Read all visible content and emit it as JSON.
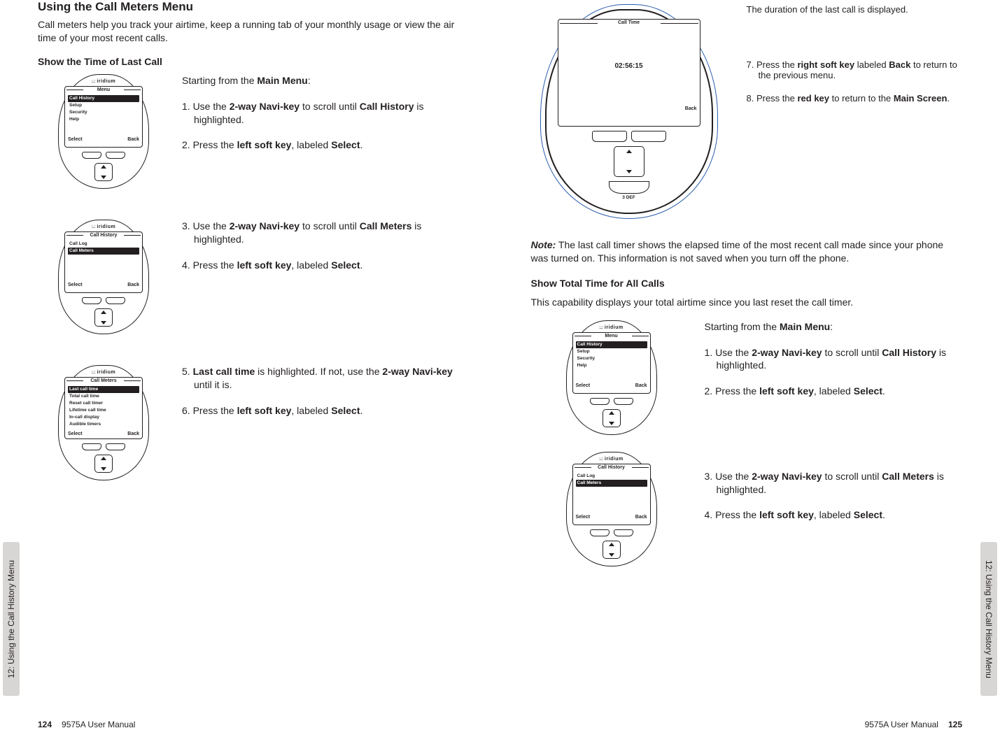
{
  "chapter_tab": "12: Using the Call History Menu",
  "footer_manual": "9575A User Manual",
  "page_left_num": "124",
  "page_right_num": "125",
  "left": {
    "title": "Using the Call Meters Menu",
    "intro": "Call meters help you track your airtime, keep a running tab of your monthly usage or view the air time of your most recent calls.",
    "sub1": "Show the Time of Last Call",
    "block1_intro": "Starting from the ",
    "block1_intro_b": "Main Menu",
    "block1_intro_tail": ":",
    "block1_s1_pre": "1. Use the ",
    "block1_s1_b1": "2-way Navi-key",
    "block1_s1_mid": " to scroll until ",
    "block1_s1_b2": "Call History",
    "block1_s1_tail": " is highlighted.",
    "block1_s2_pre": "2. Press the ",
    "block1_s2_b1": "left soft key",
    "block1_s2_mid": ", labeled ",
    "block1_s2_b2": "Select",
    "block1_s2_tail": ".",
    "block2_s3_pre": "3. Use the ",
    "block2_s3_b1": "2-way Navi-key",
    "block2_s3_mid": " to scroll until ",
    "block2_s3_b2": "Call Meters",
    "block2_s3_tail": " is highlighted.",
    "block2_s4_pre": "4. Press the ",
    "block2_s4_b1": "left soft key",
    "block2_s4_mid": ", labeled ",
    "block2_s4_b2": "Select",
    "block2_s4_tail": ".",
    "block3_s5_pre": "5. ",
    "block3_s5_b1": "Last call time",
    "block3_s5_mid": " is highlighted. If not, use the ",
    "block3_s5_b2": "2-way Navi-key",
    "block3_s5_tail": " until it is.",
    "block3_s6_pre": "6. Press the ",
    "block3_s6_b1": "left soft key",
    "block3_s6_mid": ", labeled ",
    "block3_s6_b2": "Select",
    "block3_s6_tail": ".",
    "phone1": {
      "brand": "iridium",
      "screen_title": "Menu",
      "rows": [
        "Call History",
        "Setup",
        "Security",
        "Help"
      ],
      "highlight": 0,
      "soft_l": "Select",
      "soft_r": "Back",
      "scroll_arrow": "↑"
    },
    "phone2": {
      "brand": "iridium",
      "screen_title": "Call History",
      "rows": [
        "Call Log",
        "Call Meters"
      ],
      "highlight": 1,
      "soft_l": "Select",
      "soft_r": "Back"
    },
    "phone3": {
      "brand": "iridium",
      "screen_title": "Call Meters",
      "rows": [
        "Last call time",
        "Total call time",
        "Reset call timer",
        "Lifetime call time",
        "In-call display",
        "Audible timers"
      ],
      "highlight": 0,
      "soft_l": "Select",
      "soft_r": "Back"
    }
  },
  "right": {
    "diag": {
      "screen_title": "Call Time",
      "value": "02:56:15",
      "soft_r": "Back",
      "def": "3 DEF"
    },
    "d_line1": "The duration of the last call is displayed.",
    "d_line2_pre": "7. Press the ",
    "d_line2_b1": "right soft key",
    "d_line2_mid": " labeled ",
    "d_line2_b2": "Back",
    "d_line2_tail": " to return to the previous menu.",
    "d_line3_pre": "8. Press the ",
    "d_line3_b1": "red key",
    "d_line3_mid": " to return to the ",
    "d_line3_b2": "Main Screen",
    "d_line3_tail": ".",
    "note_label": "Note:",
    "note_body": " The last call timer shows the elapsed time of the most recent call made since your phone was turned on. This information is not saved when you turn off the phone.",
    "sub2": "Show Total Time for All Calls",
    "sub2_intro": "This capability displays your total airtime since you last reset the call timer.",
    "blockA_intro": "Starting from the ",
    "blockA_intro_b": "Main Menu",
    "blockA_intro_tail": ":",
    "blockA_s1_pre": "1. Use the ",
    "blockA_s1_b1": "2-way Navi-key",
    "blockA_s1_mid": " to scroll until ",
    "blockA_s1_b2": "Call History",
    "blockA_s1_tail": " is highlighted.",
    "blockA_s2_pre": "2. Press the ",
    "blockA_s2_b1": "left soft key",
    "blockA_s2_mid": ", labeled ",
    "blockA_s2_b2": "Select",
    "blockA_s2_tail": ".",
    "blockB_s3_pre": "3. Use the ",
    "blockB_s3_b1": "2-way Navi-key",
    "blockB_s3_mid": " to scroll until ",
    "blockB_s3_b2": "Call Meters",
    "blockB_s3_tail": " is highlighted.",
    "blockB_s4_pre": "4. Press the ",
    "blockB_s4_b1": "left soft key",
    "blockB_s4_mid": ", labeled ",
    "blockB_s4_b2": "Select",
    "blockB_s4_tail": ".",
    "phoneA": {
      "brand": "iridium",
      "screen_title": "Menu",
      "rows": [
        "Call History",
        "Setup",
        "Security",
        "Help"
      ],
      "highlight": 0,
      "soft_l": "Select",
      "soft_r": "Back",
      "scroll_arrow": "↑"
    },
    "phoneB": {
      "brand": "iridium",
      "screen_title": "Call History",
      "rows": [
        "Call Log",
        "Call Meters"
      ],
      "highlight": 1,
      "soft_l": "Select",
      "soft_r": "Back"
    }
  }
}
